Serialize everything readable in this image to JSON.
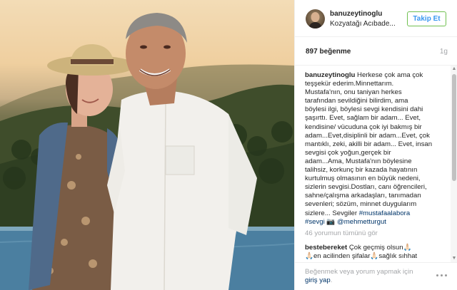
{
  "post": {
    "photo_alt": "photo-of-couple"
  },
  "header": {
    "username": "banuzeytinoglu",
    "location": "Kozyatağı Acıbade...",
    "follow_label": "Takip Et"
  },
  "stats": {
    "likes": "897 beğenme",
    "time": "1g"
  },
  "caption": {
    "username": "banuzeytinoglu",
    "lines": [
      " Herkese çok ama çok",
      "teşşekür ederim.Minnettarım.",
      "Mustafa'nın, onu taniyan herkes",
      "tarafından sevildiğini bilirdim, ama",
      "böylesi ilgi, böylesi sevgi kendisini dahi",
      "şaşırttı. Evet, sağlam bir adam... Evet,",
      "kendisine/ vücuduna çok iyi bakmış bir",
      "adam...Evet,disiplinli bir adam...Evet, çok",
      "mantıklı, zeki, akilli bir adam... Evet, insan",
      "sevgisi çok yoğun,gerçek bir",
      "adam...Ama, Mustafa'nın böylesine",
      "talihsiz, korkunç bir kazada hayatının",
      "kurtulmuş olmasının en büyük nedeni,",
      "sizlerin sevgisi.Dostları, canı öğrencileri,",
      "sahne/çalışma arkadaşları, tanımadan",
      "sevenleri; sözüm, minnet duygularım",
      "sizlere... Sevgiler "
    ],
    "hashtag1": "#mustafaalabora",
    "hashtag2": "#sevgi",
    "camera_glyph": "📷",
    "mention": "@mehmetturgut"
  },
  "comments": {
    "view_all": "46 yorumun tümünü gör",
    "second": {
      "username": "bestebereket",
      "line1": " Çok geçmiş olsun🙏🏻",
      "line2": "🙏🏻en acilinden şifalar🙏🏻sağlık sıhhat"
    }
  },
  "footer": {
    "prompt": "Beğenmek veya yorum yapmak için",
    "login": "giriş yap",
    "login_suffix": "."
  },
  "colors": {
    "link": "#003569",
    "follow_text": "#3897f0",
    "follow_border": "#70c050",
    "muted": "#a5a7aa"
  },
  "icons": {
    "more": "more-options-icon",
    "scroll_up": "scroll-up-arrow-icon",
    "scroll_down": "scroll-down-arrow-icon"
  }
}
